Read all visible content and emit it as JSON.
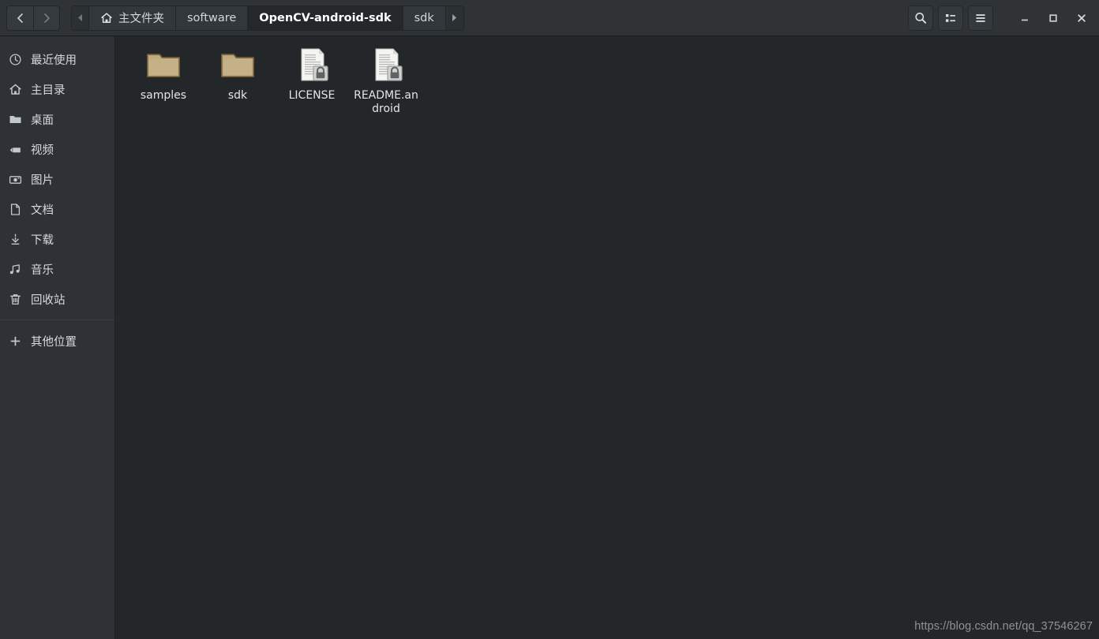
{
  "window": {
    "title": "OpenCV-android-sdk",
    "theme": {
      "header_bg": "#2f3336",
      "sidebar_bg": "#2e3236",
      "content_bg": "#232729",
      "text": "#d6dadd",
      "folder_fill": "#c8b48a",
      "folder_edge": "#8a7547"
    }
  },
  "navigation": {
    "back_label": "Back",
    "back_icon": "chevron-left-icon",
    "forward_label": "Forward",
    "forward_icon": "chevron-right-icon",
    "forward_disabled": true
  },
  "breadcrumb": {
    "scroll_left_icon": "triangle-left-icon",
    "scroll_right_icon": "triangle-right-icon",
    "items": [
      {
        "label": "主文件夹",
        "icon": "home-icon",
        "current": false
      },
      {
        "label": "software",
        "icon": "",
        "current": false
      },
      {
        "label": "OpenCV-android-sdk",
        "icon": "",
        "current": true
      },
      {
        "label": "sdk",
        "icon": "",
        "current": false
      }
    ]
  },
  "toolbar": {
    "search_label": "Search",
    "search_icon": "search-icon",
    "view_label": "View options",
    "view_icon": "list-view-icon",
    "menu_label": "Main menu",
    "menu_icon": "hamburger-menu-icon"
  },
  "window_controls": {
    "minimize_label": "Minimize",
    "minimize_icon": "minimize-icon",
    "maximize_label": "Maximize",
    "maximize_icon": "maximize-icon",
    "close_label": "Close",
    "close_icon": "close-icon"
  },
  "sidebar": {
    "items": [
      {
        "label": "最近使用",
        "icon": "clock-icon"
      },
      {
        "label": "主目录",
        "icon": "home-icon"
      },
      {
        "label": "桌面",
        "icon": "folder-icon"
      },
      {
        "label": "视频",
        "icon": "video-icon"
      },
      {
        "label": "图片",
        "icon": "camera-icon"
      },
      {
        "label": "文档",
        "icon": "document-icon"
      },
      {
        "label": "下载",
        "icon": "download-icon"
      },
      {
        "label": "音乐",
        "icon": "music-note-icon"
      },
      {
        "label": "回收站",
        "icon": "trash-icon"
      }
    ],
    "other_locations": {
      "label": "其他位置",
      "icon": "plus-icon"
    }
  },
  "files": [
    {
      "name": "samples",
      "type": "folder",
      "icon": "folder-icon"
    },
    {
      "name": "sdk",
      "type": "folder",
      "icon": "folder-icon"
    },
    {
      "name": "LICENSE",
      "type": "file",
      "icon": "locked-document-icon"
    },
    {
      "name": "README.android",
      "type": "file",
      "icon": "locked-document-icon"
    }
  ],
  "watermark": {
    "text": "https://blog.csdn.net/qq_37546267"
  }
}
